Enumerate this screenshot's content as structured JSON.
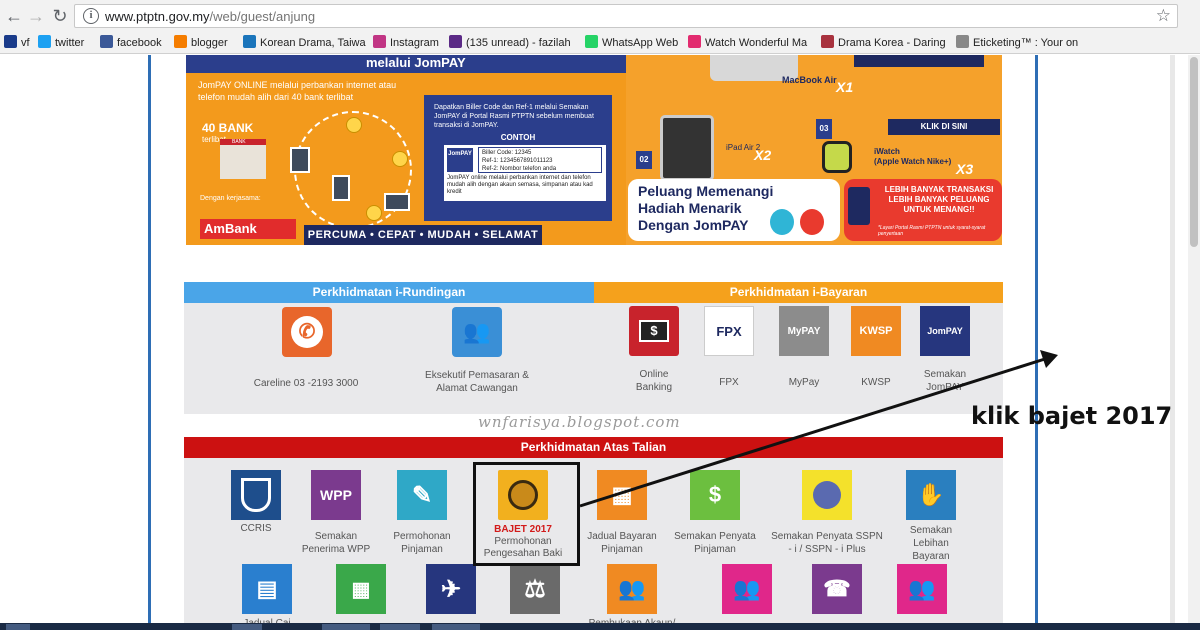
{
  "browser": {
    "url_host": "www.ptptn.gov.my",
    "url_path": "/web/guest/anjung",
    "back_icon": "arrow-left-icon",
    "forward_icon": "arrow-right-icon",
    "reload_icon": "reload-icon",
    "info_icon": "info-icon",
    "star_icon": "star-icon"
  },
  "bookmarks": [
    {
      "label": "vf",
      "color": "#1a3b8a"
    },
    {
      "label": "twitter",
      "color": "#1da1f2"
    },
    {
      "label": "facebook",
      "color": "#3b5998"
    },
    {
      "label": "blogger",
      "color": "#f57d00"
    },
    {
      "label": "Korean Drama, Taiwa",
      "color": "#1b75bb"
    },
    {
      "label": "Instagram",
      "color": "#c13584"
    },
    {
      "label": "(135 unread) - fazilah",
      "color": "#5b2a86"
    },
    {
      "label": "WhatsApp Web",
      "color": "#25d366"
    },
    {
      "label": "Watch Wonderful Ma",
      "color": "#e22b6f"
    },
    {
      "label": "Drama Korea - Daring",
      "color": "#a8323e"
    },
    {
      "label": "Eticketing™ : Your onl",
      "color": "#888888"
    }
  ],
  "banner": {
    "title_fragment": "melalui JomPAY",
    "intro": "JomPAY ONLINE melalui perbankan internet atau telefon mudah alih dari 40 bank terlibat",
    "bank40": "40 BANK",
    "bank40_sub": "terlibat",
    "bank_sign": "BANK",
    "dengan": "Dengan kerjasama:",
    "ambank": "AmBank",
    "box_text": "Dapatkan Biller Code dan Ref-1 melalui Semakan JomPAY di Portal Rasmi PTPTN sebelum membuat transaksi di JomPAY.",
    "contoh": "CONTOH",
    "jompay_logo": "JomPAY",
    "biller_code": "Biller Code: 12345",
    "ref1": "Ref-1: 1234567891011123",
    "ref2": "Ref-2: Nombor telefon anda",
    "box_desc": "JomPAY online melalui perbankan internet dan telefon mudah alih dengan akaun semasa, simpanan atau kad kredit",
    "footer": "PERCUMA • CEPAT • MUDAH • SELAMAT",
    "macbook": "MacBook Air",
    "x1": "X1",
    "badge02": "02",
    "ipad": "iPad Air 2",
    "x2": "X2",
    "klik": "KLIK DI SINI",
    "badge03": "03",
    "iwatch": "iWatch",
    "iwatch_sub": "(Apple Watch Nike+)",
    "x3": "X3",
    "peluang_1": "Peluang Memenangi",
    "peluang_2": "Hadiah Menarik",
    "peluang_3": "Dengan JomPAY",
    "lebih": "LEBIH BANYAK TRANSAKSI LEBIH BANYAK PELUANG UNTUK MENANG!!",
    "lebih_small": "*Layari Portal Rasmi PTPTN untuk syarat-syarat penyertaan"
  },
  "rundingan": {
    "title": "Perkhidmatan i-Rundingan",
    "color": "#4aa5e8",
    "items": [
      {
        "label": "Careline 03 -2193 3000",
        "icon": "phone-icon",
        "color": "#e8662b"
      },
      {
        "label": "Eksekutif Pemasaran &",
        "label2": "Alamat Cawangan",
        "icon": "people-icon",
        "color": "#3a8fd6"
      }
    ]
  },
  "bayaran": {
    "title": "Perkhidmatan i-Bayaran",
    "color": "#f5a11c",
    "items": [
      {
        "label": "Online",
        "label2": "Banking",
        "icon": "online-banking-icon",
        "color": "#c8232c",
        "glyph": "$"
      },
      {
        "label": "FPX",
        "icon": "fpx-icon",
        "color": "#ffffff",
        "glyph": "FPX"
      },
      {
        "label": "MyPay",
        "icon": "mypay-icon",
        "color": "#8c8c8c",
        "glyph": "MyPAY"
      },
      {
        "label": "KWSP",
        "icon": "kwsp-icon",
        "color": "#f08a22",
        "glyph": "KWSP"
      },
      {
        "label": "Semakan",
        "label2": "JomPAY",
        "icon": "jompay-icon",
        "color": "#26367e",
        "glyph": "JomPAY"
      }
    ]
  },
  "watermark": "wnfarisya.blogspot.com",
  "talian": {
    "title": "Perkhidmatan Atas Talian",
    "color": "#cc1111",
    "items": [
      {
        "label": "CCRIS",
        "icon": "ccris-icon",
        "color": "#1e4e8c"
      },
      {
        "label": "Semakan",
        "label2": "Penerima WPP",
        "icon": "wpp-icon",
        "color": "#7b3a8e",
        "glyph": "WPP"
      },
      {
        "label": "Permohonan",
        "label2": "Pinjaman",
        "icon": "form-edit-icon",
        "color": "#2fa8c7"
      },
      {
        "label": "BAJET 2017",
        "label2": "Permohonan",
        "label3": "Pengesahan Baki",
        "icon": "bajet-2017-icon",
        "color": "#f2b01e"
      },
      {
        "label": "Jadual Bayaran",
        "label2": "Pinjaman",
        "icon": "calendar-icon",
        "color": "#f08a22"
      },
      {
        "label": "Semakan Penyata",
        "label2": "Pinjaman",
        "icon": "statement-icon",
        "color": "#6cbf3f",
        "glyph": "$"
      },
      {
        "label": "Semakan Penyata SSPN",
        "label2": "- i / SSPN - i Plus",
        "icon": "sspn-icon",
        "color": "#f4e12b"
      },
      {
        "label": "Semakan",
        "label2": "Lebihan",
        "label3": "Bayaran",
        "icon": "refund-icon",
        "color": "#2a7fbf"
      }
    ],
    "row2": [
      {
        "label": "Jadual Caj",
        "icon": "document-icon",
        "color": "#2a7fcf"
      },
      {
        "label": "",
        "icon": "calendar-money-icon",
        "color": "#3aa84a"
      },
      {
        "label": "",
        "icon": "airplane-icon",
        "color": "#26367e"
      },
      {
        "label": "",
        "icon": "scales-icon",
        "color": "#6a6a6a"
      },
      {
        "label": "Pembukaan Akaun/",
        "icon": "group-plus-icon",
        "color": "#f08a22"
      },
      {
        "label": "",
        "icon": "users-icon",
        "color": "#e0278a"
      },
      {
        "label": "",
        "icon": "support-agent-icon",
        "color": "#7b3a8e"
      },
      {
        "label": "",
        "icon": "group-icon",
        "color": "#e0278a"
      }
    ]
  },
  "annotation": "klik bajet 2017"
}
